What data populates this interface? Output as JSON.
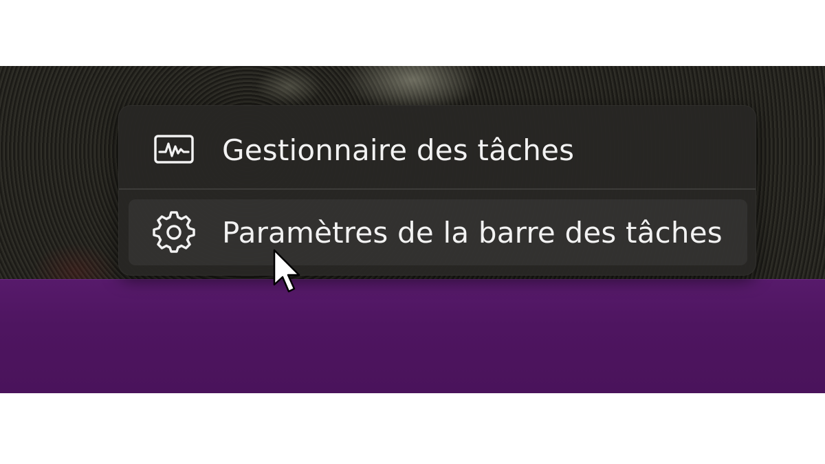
{
  "context_menu": {
    "items": [
      {
        "label": "Gestionnaire des tâches",
        "icon": "task-manager-icon"
      },
      {
        "label": "Paramètres de la barre des tâches",
        "icon": "gear-icon"
      }
    ]
  },
  "taskbar": {
    "color": "#4e1560"
  },
  "cursor": {
    "icon": "mouse-pointer-icon"
  }
}
